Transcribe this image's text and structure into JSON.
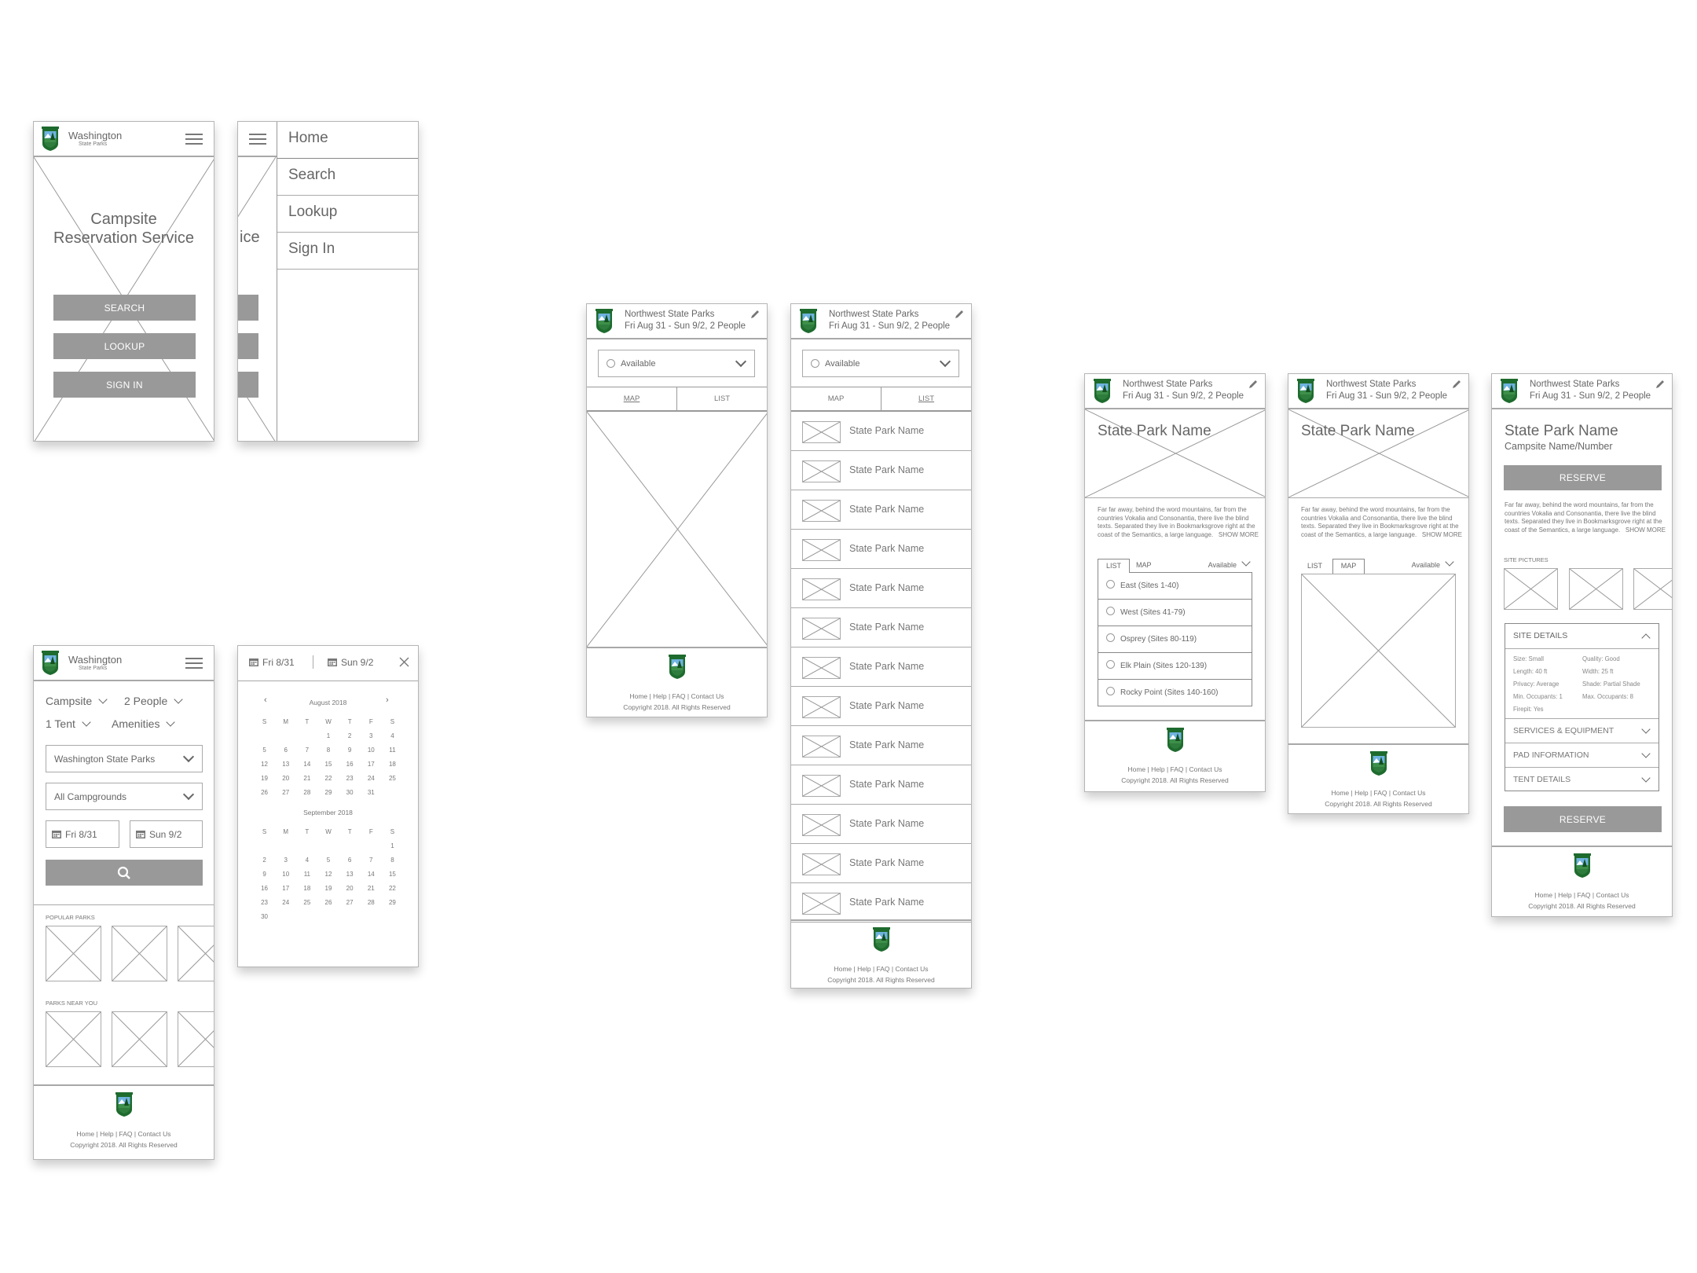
{
  "brand": {
    "name": "Washington",
    "sub": "State Parks"
  },
  "colors": {
    "button_gray": "#999999",
    "border_gray": "#aaaaaa",
    "text_gray": "#666666",
    "logo_green": "#1e6b2e",
    "logo_sky": "#6fb3e0"
  },
  "icons": {
    "logo": "state-parks-shield",
    "menu": "hamburger",
    "edit": "pencil",
    "calendar": "calendar",
    "search": "magnifier",
    "close": "x",
    "dropdown": "chevron-down"
  },
  "home": {
    "title_line1": "Campsite",
    "title_line2": "Reservation Service",
    "buttons": [
      "SEARCH",
      "LOOKUP",
      "SIGN IN"
    ]
  },
  "menu": {
    "partial_title": "ice",
    "items": [
      "Home",
      "Search",
      "Lookup",
      "Sign In"
    ]
  },
  "search": {
    "filters": [
      "Campsite",
      "2 People",
      "1 Tent",
      "Amenities"
    ],
    "park_select": "Washington State Parks",
    "campground_select": "All Campgrounds",
    "start_date": "Fri 8/31",
    "end_date": "Sun 9/2",
    "popular_label": "POPULAR PARKS",
    "near_label": "PARKS NEAR YOU"
  },
  "calendar": {
    "start_date": "Fri 8/31",
    "end_date": "Sun 9/2",
    "weekdays": [
      "S",
      "M",
      "T",
      "W",
      "T",
      "F",
      "S"
    ],
    "months": [
      {
        "title": "August 2018",
        "weeks": [
          [
            "",
            "",
            "",
            "1",
            "2",
            "3",
            "4"
          ],
          [
            "5",
            "6",
            "7",
            "8",
            "9",
            "10",
            "11"
          ],
          [
            "12",
            "13",
            "14",
            "15",
            "16",
            "17",
            "18"
          ],
          [
            "19",
            "20",
            "21",
            "22",
            "23",
            "24",
            "25"
          ],
          [
            "26",
            "27",
            "28",
            "29",
            "30",
            "31",
            ""
          ]
        ]
      },
      {
        "title": "September 2018",
        "weeks": [
          [
            "",
            "",
            "",
            "",
            "",
            "",
            "1"
          ],
          [
            "2",
            "3",
            "4",
            "5",
            "6",
            "7",
            "8"
          ],
          [
            "9",
            "10",
            "11",
            "12",
            "13",
            "14",
            "15"
          ],
          [
            "16",
            "17",
            "18",
            "19",
            "20",
            "21",
            "22"
          ],
          [
            "23",
            "24",
            "25",
            "26",
            "27",
            "28",
            "29"
          ],
          [
            "30",
            "",
            "",
            "",
            "",
            "",
            ""
          ]
        ]
      }
    ]
  },
  "results_header": {
    "title": "Northwest State Parks",
    "subtitle": "Fri Aug 31 - Sun 9/2, 2 People"
  },
  "results": {
    "filter": "Available",
    "tabs": [
      "MAP",
      "LIST"
    ],
    "items": [
      "State Park Name",
      "State Park Name",
      "State Park Name",
      "State Park Name",
      "State Park Name",
      "State Park Name",
      "State Park Name",
      "State Park Name",
      "State Park Name",
      "State Park Name",
      "State Park Name",
      "State Park Name",
      "State Park Name"
    ]
  },
  "park": {
    "name": "State Park Name",
    "description": "Far far away, behind the word mountains, far from the countries Vokalia and Consonantia, there live the blind texts. Separated they live in Bookmarksgrove right at the coast of the Semantics, a large language...",
    "show_more": "SHOW MORE",
    "tabs": [
      "LIST",
      "MAP"
    ],
    "filter": "Available",
    "loops": [
      "East (Sites 1-40)",
      "West (Sites 41-79)",
      "Osprey (Sites 80-119)",
      "Elk Plain (Sites 120-139)",
      "Rocky Point (Sites 140-160)"
    ]
  },
  "site": {
    "park_name": "State Park Name",
    "campsite": "Campsite Name/Number",
    "reserve": "RESERVE",
    "pictures_label": "SITE PICTURES",
    "details_title": "SITE DETAILS",
    "details": [
      "Size: Small",
      "Quality: Good",
      "Length: 40 ft",
      "Width: 25 ft",
      "Privacy: Average",
      "Shade: Partial Shade",
      "Min. Occupants: 1",
      "Max. Occupants: 8",
      "Firepit: Yes"
    ],
    "sections": [
      "SERVICES & EQUIPMENT",
      "PAD INFORMATION",
      "TENT DETAILS"
    ]
  },
  "footer": {
    "links": [
      "Home",
      "Help",
      "FAQ",
      "Contact Us"
    ],
    "copyright": "Copyright 2018. All Rights Reserved"
  }
}
